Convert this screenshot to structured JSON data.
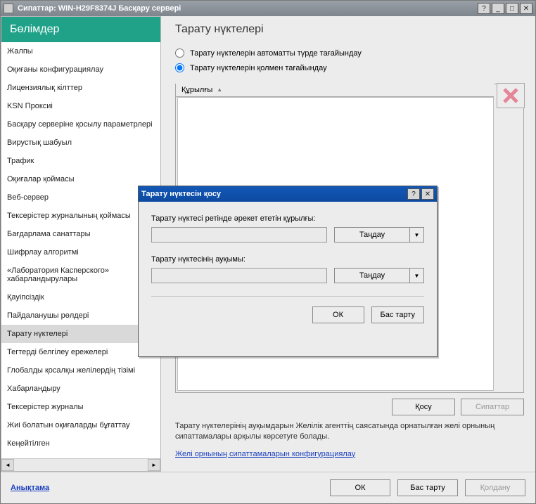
{
  "window": {
    "title": "Сипаттар: WIN-H29F8374J Басқару сервері"
  },
  "sidebar": {
    "header": "Бөлімдер",
    "items": [
      {
        "label": "Жалпы"
      },
      {
        "label": "Оқиғаны конфигурациялау"
      },
      {
        "label": "Лицензиялық кілттер"
      },
      {
        "label": "KSN Проксиі"
      },
      {
        "label": "Басқару серверіне қосылу параметрлері"
      },
      {
        "label": "Вирустық шабуыл"
      },
      {
        "label": "Трафик"
      },
      {
        "label": "Оқиғалар қоймасы"
      },
      {
        "label": "Веб-сервер"
      },
      {
        "label": "Тексерістер журналының қоймасы"
      },
      {
        "label": "Бағдарлама санаттары"
      },
      {
        "label": "Шифрлау алгоритмі"
      },
      {
        "label": "«Лаборатория Касперского» хабарландырулары"
      },
      {
        "label": "Қауіпсіздік"
      },
      {
        "label": "Пайдаланушы рөлдері"
      },
      {
        "label": "Тарату нүктелері",
        "selected": true
      },
      {
        "label": "Тегтерді белгілеу ережелері"
      },
      {
        "label": "Глобалды қосалқы желілердің тізімі"
      },
      {
        "label": "Хабарландыру"
      },
      {
        "label": "Тексерістер журналы"
      },
      {
        "label": "Жиі болатын оқиғаларды бұғаттау"
      },
      {
        "label": "Кеңейтілген"
      }
    ]
  },
  "main": {
    "title": "Тарату нүктелері",
    "radio_auto": "Тарату нүктелерін автоматты түрде тағайындау",
    "radio_manual": "Тарату нүктелерін қолмен тағайындау",
    "column_device": "Құрылғы",
    "btn_add": "Қосу",
    "btn_props": "Сипаттар",
    "advice": "Тарату нүктелерінің ауқымдарын Желілік агенттің саясатында орнатылған желі орнының сипаттамалары арқылы көрсетуге болады.",
    "link": "Желі орнының сипаттамаларын конфигурациялау"
  },
  "footer": {
    "help": "Анықтама",
    "ok": "ОК",
    "cancel": "Бас тарту",
    "apply": "Қолдану"
  },
  "modal": {
    "title": "Тарату нүктесін қосу",
    "label_device": "Тарату нүктесі ретінде әрекет ететін құрылғы:",
    "label_scope": "Тарату нүктесінің ауқымы:",
    "btn_select": "Таңдау",
    "ok": "ОК",
    "cancel": "Бас тарту"
  }
}
